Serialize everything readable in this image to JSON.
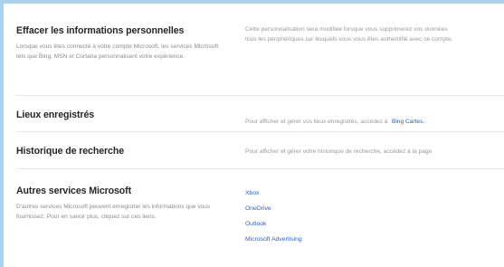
{
  "sections": [
    {
      "title": "Effacer les informations personnelles",
      "description": "Lorsque vous êtes connecté à votre compte Microsoft, les services Microsoft tels que Bing, MSN et Cortana personnalisent votre expérience.",
      "right_text": "Cette personnalisation sera modifiée lorsque vous supprimerez vos données",
      "right_text_2": "tous les périphériques sur lesquels vous vous êtes authentifié avec ce compte."
    },
    {
      "title": "Lieux enregistrés",
      "right_text": "Pour afficher et gérer vos lieux enregistrés, accédez à",
      "right_link": "Bing Cartes."
    },
    {
      "title": "Historique de recherche",
      "right_text": "Pour afficher et gérer votre historique de recherche, accédez à la page"
    },
    {
      "title": "Autres services Microsoft",
      "description": "D'autres services Microsoft peuvent enregistrer les informations que vous fournissez. Pour en savoir plus, cliquez sur ces liens.",
      "links": [
        "Xbox",
        "OneDrive",
        "Outlook",
        "Microsoft Advertising"
      ]
    }
  ]
}
